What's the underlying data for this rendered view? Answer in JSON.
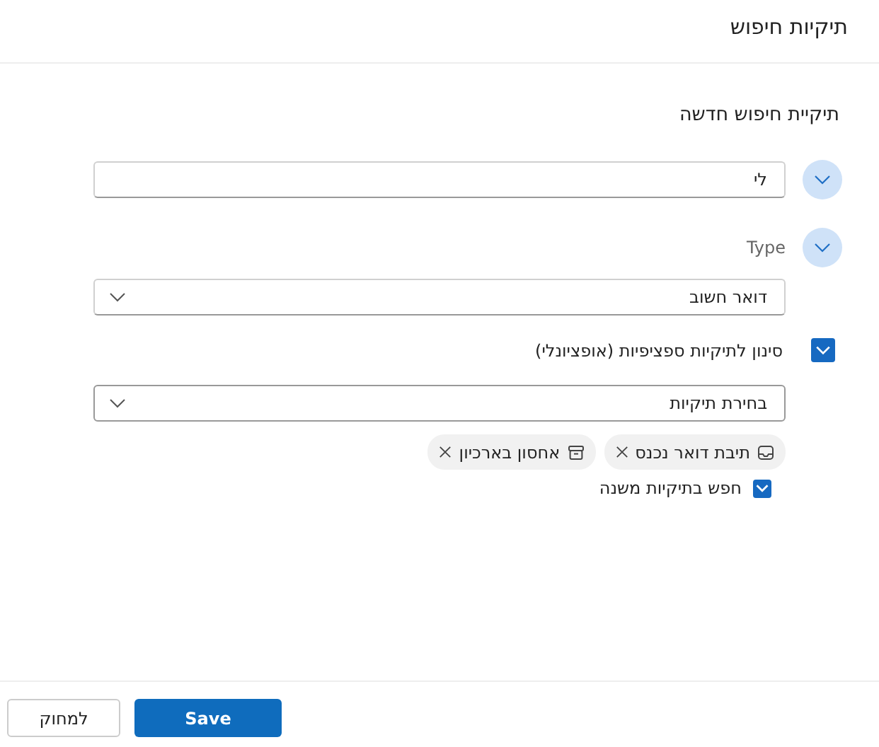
{
  "window": {
    "title": "תיקיות חיפוש"
  },
  "heading": "תיקיית חיפוש חדשה",
  "name_field": {
    "value": "לי",
    "expanded": false
  },
  "type_section": {
    "label": "Type",
    "expanded": false,
    "dropdown": {
      "value": "דואר חשוב"
    }
  },
  "filter": {
    "label": "סינון לתיקיות ספציפיות (אופציונלי)",
    "checked": true,
    "dropdown": {
      "placeholder": "בחירת תיקיות"
    },
    "chips": [
      {
        "label": "תיבת דואר נכנס",
        "kind": "inbox"
      },
      {
        "label": "אחסון בארכיון",
        "kind": "archive"
      }
    ]
  },
  "subfolders": {
    "label": "חפש בתיקיות משנה",
    "checked": true
  },
  "buttons": [
    {
      "label": "Save",
      "kind": "primary"
    },
    {
      "label": "למחוק",
      "kind": "secondary"
    }
  ]
}
